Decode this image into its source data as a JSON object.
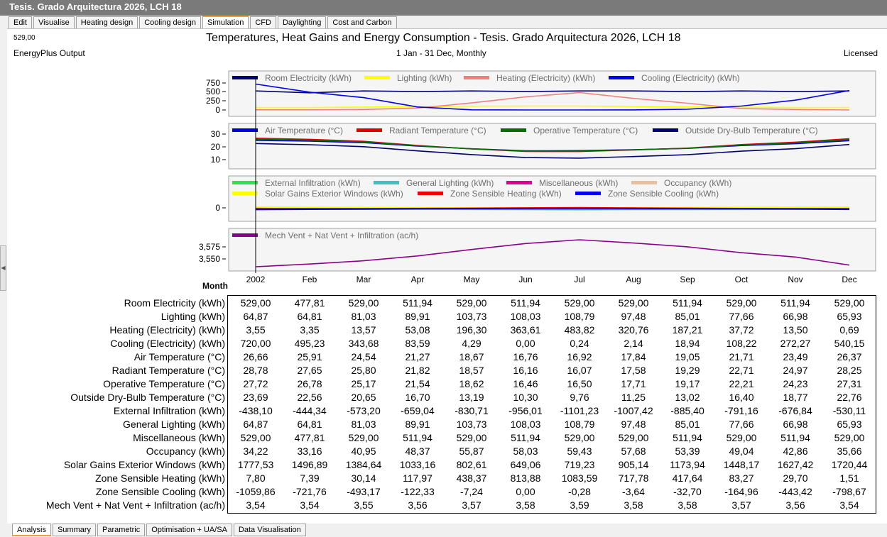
{
  "window": {
    "title": "Tesis. Grado Arquitectura 2026, LCH 18"
  },
  "top_tabs": [
    {
      "label": "Edit"
    },
    {
      "label": "Visualise"
    },
    {
      "label": "Heating design"
    },
    {
      "label": "Cooling design"
    },
    {
      "label": "Simulation",
      "active": true
    },
    {
      "label": "CFD"
    },
    {
      "label": "Daylighting"
    },
    {
      "label": "Cost and Carbon"
    }
  ],
  "bottom_tabs": [
    {
      "label": "Analysis",
      "active": true
    },
    {
      "label": "Summary"
    },
    {
      "label": "Parametric"
    },
    {
      "label": "Optimisation + UA/SA"
    },
    {
      "label": "Data Visualisation"
    }
  ],
  "report": {
    "readout": "529,00",
    "title": "Temperatures, Heat Gains and Energy Consumption - Tesis. Grado Arquitectura 2026, LCH 18",
    "source": "EnergyPlus Output",
    "period": "1 Jan - 31 Dec, Monthly",
    "license": "Licensed",
    "month_axis_label": "Month"
  },
  "colors": {
    "room_electricity": "#00006e",
    "lighting": "#ffff00",
    "heating": "#f08080",
    "cooling": "#0000f0",
    "air_temp": "#0000e0",
    "radiant_temp": "#e00000",
    "operative_temp": "#007000",
    "outside_temp": "#00006e",
    "ext_infiltration": "#30e050",
    "general_lighting": "#40c0c0",
    "miscellaneous": "#e00090",
    "occupancy": "#e8c0a0",
    "solar_gains": "#ffff00",
    "zone_heating": "#f00000",
    "zone_cooling": "#0000f0",
    "ventilation": "#8b008b",
    "table_border": "#000000",
    "tab_accent": "#e8a040"
  },
  "chart_data": [
    {
      "type": "line",
      "x": [
        "2002",
        "Feb",
        "Mar",
        "Apr",
        "May",
        "Jun",
        "Jul",
        "Aug",
        "Sep",
        "Oct",
        "Nov",
        "Dec"
      ],
      "ylim": [
        0,
        750
      ],
      "yticks": [
        "750",
        "500",
        "250",
        "0"
      ],
      "series": [
        {
          "name": "Room Electricity (kWh)",
          "values": [
            529.0,
            477.81,
            529.0,
            511.94,
            529.0,
            511.94,
            529.0,
            529.0,
            511.94,
            529.0,
            511.94,
            529.0
          ]
        },
        {
          "name": "Lighting (kWh)",
          "values": [
            64.87,
            64.81,
            81.03,
            89.91,
            103.73,
            108.03,
            108.79,
            97.48,
            85.01,
            77.66,
            66.98,
            65.93
          ]
        },
        {
          "name": "Heating (Electricity) (kWh)",
          "values": [
            3.55,
            3.35,
            13.57,
            53.08,
            196.3,
            363.61,
            483.82,
            320.76,
            187.21,
            37.72,
            13.5,
            0.69
          ]
        },
        {
          "name": "Cooling (Electricity) (kWh)",
          "values": [
            720.0,
            495.23,
            343.68,
            83.59,
            4.29,
            0.0,
            0.24,
            2.14,
            18.94,
            108.22,
            272.27,
            540.15
          ]
        }
      ]
    },
    {
      "type": "line",
      "x": [
        "2002",
        "Feb",
        "Mar",
        "Apr",
        "May",
        "Jun",
        "Jul",
        "Aug",
        "Sep",
        "Oct",
        "Nov",
        "Dec"
      ],
      "ylim": [
        5,
        32
      ],
      "yticks": [
        "30",
        "20",
        "10"
      ],
      "series": [
        {
          "name": "Air Temperature (°C)",
          "values": [
            26.66,
            25.91,
            24.54,
            21.27,
            18.67,
            16.76,
            16.92,
            17.84,
            19.05,
            21.71,
            23.49,
            26.37
          ]
        },
        {
          "name": "Radiant Temperature (°C)",
          "values": [
            28.78,
            27.65,
            25.8,
            21.82,
            18.57,
            16.16,
            16.07,
            17.58,
            19.29,
            22.71,
            24.97,
            28.25
          ]
        },
        {
          "name": "Operative Temperature (°C)",
          "values": [
            27.72,
            26.78,
            25.17,
            21.54,
            18.62,
            16.46,
            16.5,
            17.71,
            19.17,
            22.21,
            24.23,
            27.31
          ]
        },
        {
          "name": "Outside Dry-Bulb Temperature (°C)",
          "values": [
            23.69,
            22.56,
            20.65,
            16.7,
            13.19,
            10.3,
            9.76,
            11.25,
            13.02,
            16.4,
            18.77,
            22.76
          ]
        }
      ]
    },
    {
      "type": "line",
      "x": [
        "2002",
        "Feb",
        "Mar",
        "Apr",
        "May",
        "Jun",
        "Jul",
        "Aug",
        "Sep",
        "Oct",
        "Nov",
        "Dec"
      ],
      "ylim": [
        -8000,
        13000
      ],
      "yticks": [
        "0"
      ],
      "series": [
        {
          "name": "External Infiltration (kWh)",
          "values": [
            -438.1,
            -444.34,
            -573.2,
            -659.04,
            -830.71,
            -956.01,
            -1101.23,
            -1007.42,
            -885.4,
            -791.16,
            -676.84,
            -530.11
          ]
        },
        {
          "name": "General Lighting (kWh)",
          "values": [
            64.87,
            64.81,
            81.03,
            89.91,
            103.73,
            108.03,
            108.79,
            97.48,
            85.01,
            77.66,
            66.98,
            65.93
          ]
        },
        {
          "name": "Miscellaneous (kWh)",
          "values": [
            529.0,
            477.81,
            529.0,
            511.94,
            529.0,
            511.94,
            529.0,
            529.0,
            511.94,
            529.0,
            511.94,
            529.0
          ]
        },
        {
          "name": "Occupancy (kWh)",
          "values": [
            34.22,
            33.16,
            40.95,
            48.37,
            55.87,
            58.03,
            59.43,
            57.68,
            53.39,
            49.04,
            42.86,
            35.66
          ]
        },
        {
          "name": "Solar Gains Exterior Windows (kWh)",
          "values": [
            1777.53,
            1496.89,
            1384.64,
            1033.16,
            802.61,
            649.06,
            719.23,
            905.14,
            1173.94,
            1448.17,
            1627.42,
            1720.44
          ]
        },
        {
          "name": "Zone Sensible Heating (kWh)",
          "values": [
            7.8,
            7.39,
            30.14,
            117.97,
            438.37,
            813.88,
            1083.59,
            717.78,
            417.64,
            83.27,
            29.7,
            1.51
          ]
        },
        {
          "name": "Zone Sensible Cooling (kWh)",
          "values": [
            -1059.86,
            -721.76,
            -493.17,
            -122.33,
            -7.24,
            0.0,
            -0.28,
            -3.64,
            -32.7,
            -164.96,
            -443.42,
            -798.67
          ]
        }
      ]
    },
    {
      "type": "line",
      "x": [
        "2002",
        "Feb",
        "Mar",
        "Apr",
        "May",
        "Jun",
        "Jul",
        "Aug",
        "Sep",
        "Oct",
        "Nov",
        "Dec"
      ],
      "ylim": [
        3.54,
        3.59
      ],
      "yticks": [
        "3,575",
        "3,550"
      ],
      "series": [
        {
          "name": "Mech Vent + Nat Vent + Infiltration (ac/h)",
          "values": [
            3.54,
            3.545,
            3.551,
            3.56,
            3.572,
            3.583,
            3.59,
            3.584,
            3.577,
            3.566,
            3.558,
            3.543
          ]
        }
      ]
    }
  ],
  "table": {
    "months": [
      "2002",
      "Feb",
      "Mar",
      "Apr",
      "May",
      "Jun",
      "Jul",
      "Aug",
      "Sep",
      "Oct",
      "Nov",
      "Dec"
    ],
    "rows": [
      {
        "label": "Room Electricity (kWh)",
        "values": [
          "529,00",
          "477,81",
          "529,00",
          "511,94",
          "529,00",
          "511,94",
          "529,00",
          "529,00",
          "511,94",
          "529,00",
          "511,94",
          "529,00"
        ]
      },
      {
        "label": "Lighting (kWh)",
        "values": [
          "64,87",
          "64,81",
          "81,03",
          "89,91",
          "103,73",
          "108,03",
          "108,79",
          "97,48",
          "85,01",
          "77,66",
          "66,98",
          "65,93"
        ]
      },
      {
        "label": "Heating (Electricity) (kWh)",
        "values": [
          "3,55",
          "3,35",
          "13,57",
          "53,08",
          "196,30",
          "363,61",
          "483,82",
          "320,76",
          "187,21",
          "37,72",
          "13,50",
          "0,69"
        ]
      },
      {
        "label": "Cooling (Electricity) (kWh)",
        "values": [
          "720,00",
          "495,23",
          "343,68",
          "83,59",
          "4,29",
          "0,00",
          "0,24",
          "2,14",
          "18,94",
          "108,22",
          "272,27",
          "540,15"
        ]
      },
      {
        "label": "Air Temperature (°C)",
        "values": [
          "26,66",
          "25,91",
          "24,54",
          "21,27",
          "18,67",
          "16,76",
          "16,92",
          "17,84",
          "19,05",
          "21,71",
          "23,49",
          "26,37"
        ]
      },
      {
        "label": "Radiant Temperature (°C)",
        "values": [
          "28,78",
          "27,65",
          "25,80",
          "21,82",
          "18,57",
          "16,16",
          "16,07",
          "17,58",
          "19,29",
          "22,71",
          "24,97",
          "28,25"
        ]
      },
      {
        "label": "Operative Temperature (°C)",
        "values": [
          "27,72",
          "26,78",
          "25,17",
          "21,54",
          "18,62",
          "16,46",
          "16,50",
          "17,71",
          "19,17",
          "22,21",
          "24,23",
          "27,31"
        ]
      },
      {
        "label": "Outside Dry-Bulb Temperature (°C)",
        "values": [
          "23,69",
          "22,56",
          "20,65",
          "16,70",
          "13,19",
          "10,30",
          "9,76",
          "11,25",
          "13,02",
          "16,40",
          "18,77",
          "22,76"
        ]
      },
      {
        "label": "External Infiltration (kWh)",
        "values": [
          "-438,10",
          "-444,34",
          "-573,20",
          "-659,04",
          "-830,71",
          "-956,01",
          "-1101,23",
          "-1007,42",
          "-885,40",
          "-791,16",
          "-676,84",
          "-530,11"
        ]
      },
      {
        "label": "General Lighting (kWh)",
        "values": [
          "64,87",
          "64,81",
          "81,03",
          "89,91",
          "103,73",
          "108,03",
          "108,79",
          "97,48",
          "85,01",
          "77,66",
          "66,98",
          "65,93"
        ]
      },
      {
        "label": "Miscellaneous (kWh)",
        "values": [
          "529,00",
          "477,81",
          "529,00",
          "511,94",
          "529,00",
          "511,94",
          "529,00",
          "529,00",
          "511,94",
          "529,00",
          "511,94",
          "529,00"
        ]
      },
      {
        "label": "Occupancy (kWh)",
        "values": [
          "34,22",
          "33,16",
          "40,95",
          "48,37",
          "55,87",
          "58,03",
          "59,43",
          "57,68",
          "53,39",
          "49,04",
          "42,86",
          "35,66"
        ]
      },
      {
        "label": "Solar Gains Exterior Windows (kWh)",
        "values": [
          "1777,53",
          "1496,89",
          "1384,64",
          "1033,16",
          "802,61",
          "649,06",
          "719,23",
          "905,14",
          "1173,94",
          "1448,17",
          "1627,42",
          "1720,44"
        ]
      },
      {
        "label": "Zone Sensible Heating (kWh)",
        "values": [
          "7,80",
          "7,39",
          "30,14",
          "117,97",
          "438,37",
          "813,88",
          "1083,59",
          "717,78",
          "417,64",
          "83,27",
          "29,70",
          "1,51"
        ]
      },
      {
        "label": "Zone Sensible Cooling (kWh)",
        "values": [
          "-1059,86",
          "-721,76",
          "-493,17",
          "-122,33",
          "-7,24",
          "0,00",
          "-0,28",
          "-3,64",
          "-32,70",
          "-164,96",
          "-443,42",
          "-798,67"
        ]
      },
      {
        "label": "Mech Vent + Nat Vent + Infiltration (ac/h)",
        "values": [
          "3,54",
          "3,54",
          "3,55",
          "3,56",
          "3,57",
          "3,58",
          "3,59",
          "3,58",
          "3,58",
          "3,57",
          "3,56",
          "3,54"
        ]
      }
    ]
  }
}
